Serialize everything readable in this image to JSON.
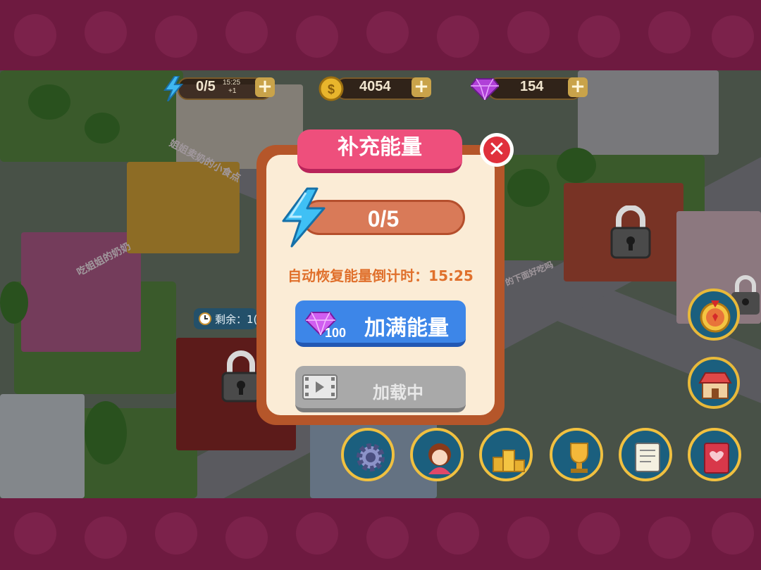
{
  "resources": {
    "energy": {
      "value": "0/5",
      "timer": "15:25",
      "increment": "+1",
      "icon": "lightning-icon"
    },
    "coins": {
      "value": "4054",
      "icon": "coin-icon"
    },
    "gems": {
      "value": "154",
      "icon": "gem-icon"
    },
    "plus_symbol": "+"
  },
  "popup": {
    "title": "补充能量",
    "close_symbol": "✕",
    "energy_display": "0/5",
    "countdown_text": "自动恢复能量倒计时：15:25",
    "fill_button": {
      "label": "加满能量",
      "cost": "100",
      "icon": "gem-icon"
    },
    "video_button": {
      "label": "加载中",
      "icon": "video-icon"
    }
  },
  "world": {
    "shop_sign_1": "姐姐卖奶的小食点",
    "shop_sign_2": "吃姐姐的奶奶",
    "shop_sign_3": "的下面好吃吗",
    "timer_label": "剩余：1("
  },
  "bottom_menu": [
    {
      "name": "settings",
      "icon": "gear-icon"
    },
    {
      "name": "friends",
      "icon": "friend-avatar-icon"
    },
    {
      "name": "ranking",
      "icon": "podium-icon"
    },
    {
      "name": "achievements",
      "icon": "trophy-icon"
    },
    {
      "name": "tasks",
      "icon": "notepad-icon"
    },
    {
      "name": "recipes",
      "icon": "recipe-book-icon"
    }
  ],
  "side_menu": [
    {
      "name": "lucky-wheel",
      "icon": "wheel-icon"
    },
    {
      "name": "shop",
      "icon": "shop-icon"
    }
  ],
  "colors": {
    "frame": "#6e1a40",
    "popup_border": "#b5562a",
    "popup_bg": "#fbecd6",
    "title_pink": "#ee4f7c",
    "fill_blue": "#3d86e8",
    "video_gray": "#a9a9a9",
    "countdown_orange": "#e0702c"
  }
}
